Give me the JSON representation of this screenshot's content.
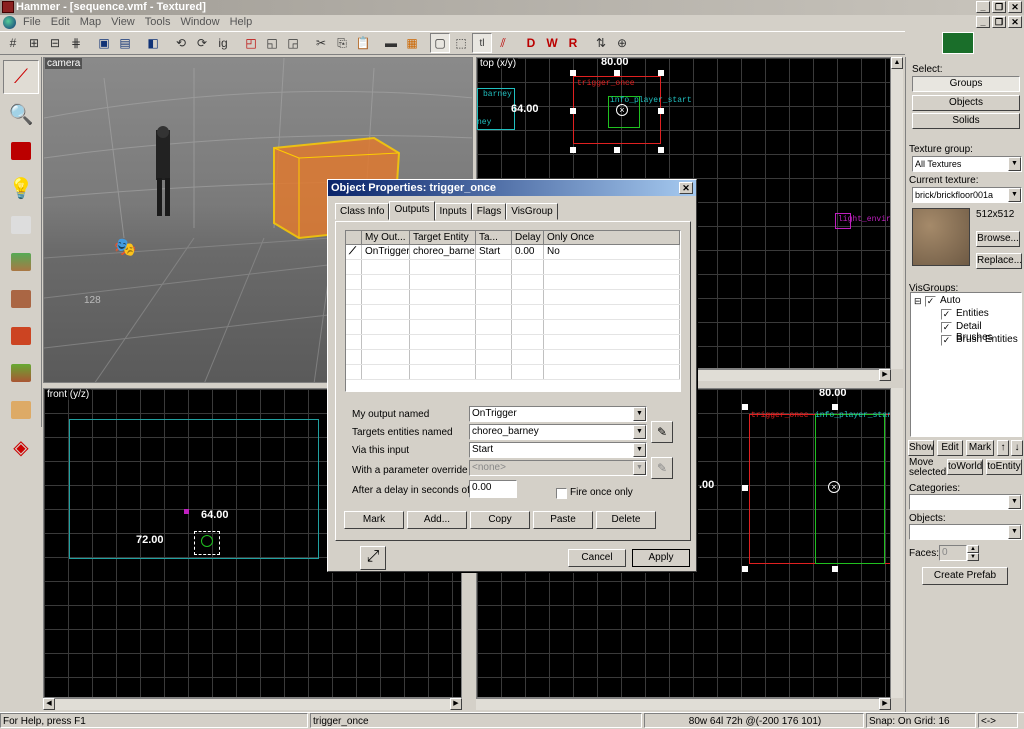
{
  "window": {
    "title": "Hammer - [sequence.vmf - Textured]"
  },
  "menu": [
    "File",
    "Edit",
    "Map",
    "View",
    "Tools",
    "Window",
    "Help"
  ],
  "views": {
    "camera": "camera",
    "top": "top (x/y)",
    "front": "front (y/z)",
    "top_dim_w": "80.00",
    "top_dim_h": "64.00",
    "front_dim_w": "64.00",
    "front_dim_h": "72.00",
    "side_dim_w": "80.00",
    "side_dim_h": ".00",
    "top_entities": [
      "trigger_once",
      "info_player_start",
      "barney",
      "ney",
      "light_envir"
    ],
    "side_entities": [
      "trigger_once",
      "info_player_start"
    ]
  },
  "dialog": {
    "title": "Object Properties: trigger_once",
    "tabs": [
      "Class Info",
      "Outputs",
      "Inputs",
      "Flags",
      "VisGroup"
    ],
    "active_tab": "Outputs",
    "columns": [
      "My Out...",
      "Target Entity",
      "Ta...",
      "Delay",
      "Only Once"
    ],
    "rows": [
      {
        "output": "OnTrigger",
        "target": "choreo_barney",
        "input": "Start",
        "delay": "0.00",
        "once": "No"
      }
    ],
    "fields": {
      "output_label": "My output named",
      "output_value": "OnTrigger",
      "target_label": "Targets entities named",
      "target_value": "choreo_barney",
      "input_label": "Via this input",
      "input_value": "Start",
      "param_label": "With a parameter override of",
      "param_value": "<none>",
      "delay_label": "After a delay in seconds of",
      "delay_value": "0.00",
      "fire_once_label": "Fire once only"
    },
    "buttons": {
      "mark": "Mark",
      "add": "Add...",
      "copy": "Copy",
      "paste": "Paste",
      "delete": "Delete",
      "cancel": "Cancel",
      "apply": "Apply"
    }
  },
  "right_panel": {
    "select_label": "Select:",
    "groups": "Groups",
    "objects": "Objects",
    "solids": "Solids",
    "texture_group_label": "Texture group:",
    "texture_group_value": "All Textures",
    "current_texture_label": "Current texture:",
    "current_texture_value": "brick/brickfloor001a",
    "texture_size": "512x512",
    "browse": "Browse...",
    "replace": "Replace...",
    "visgroups_label": "VisGroups:",
    "visgroups": [
      "Auto",
      "Entities",
      "Detail Brushes",
      "Brush Entities"
    ],
    "show": "Show",
    "edit": "Edit",
    "mark": "Mark",
    "move_selected_label": "Move selected:",
    "to_world": "toWorld",
    "to_entity": "toEntity",
    "categories_label": "Categories:",
    "objects_label": "Objects:",
    "faces_label": "Faces:",
    "faces_value": "0",
    "create_prefab": "Create Prefab"
  },
  "status": {
    "help": "For Help, press F1",
    "selection": "trigger_once",
    "coords": "80w 64l 72h @(-200 176 101)",
    "snap": "Snap: On Grid: 16",
    "extra": "<->"
  }
}
